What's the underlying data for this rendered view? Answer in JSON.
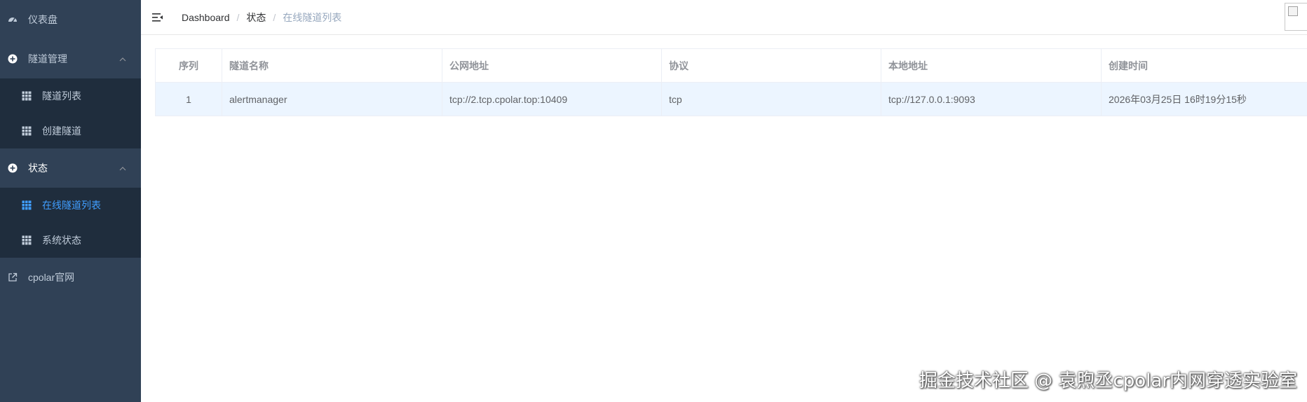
{
  "sidebar": {
    "items": [
      {
        "label": "仪表盘",
        "icon": "dashboard-icon"
      },
      {
        "label": "隧道管理",
        "icon": "plus-circle-icon",
        "expanded": true,
        "children": [
          {
            "label": "隧道列表",
            "icon": "table-icon"
          },
          {
            "label": "创建隧道",
            "icon": "table-icon"
          }
        ]
      },
      {
        "label": "状态",
        "icon": "plus-circle-icon",
        "expanded": true,
        "children": [
          {
            "label": "在线隧道列表",
            "icon": "table-icon",
            "active": true
          },
          {
            "label": "系统状态",
            "icon": "table-icon"
          }
        ]
      },
      {
        "label": "cpolar官网",
        "icon": "external-link-icon"
      }
    ]
  },
  "breadcrumb": [
    "Dashboard",
    "状态",
    "在线隧道列表"
  ],
  "table": {
    "columns": [
      "序列",
      "隧道名称",
      "公网地址",
      "协议",
      "本地地址",
      "创建时间"
    ],
    "rows": [
      [
        "1",
        "alertmanager",
        "tcp://2.tcp.cpolar.top:10409",
        "tcp",
        "tcp://127.0.0.1:9093",
        "2026年03月25日 16时19分15秒"
      ]
    ]
  },
  "watermark": "掘金技术社区 @ 袁煦丞cpolar内网穿透实验室",
  "colors": {
    "sidebar_bg": "#304156",
    "submenu_bg": "#1f2d3d",
    "active": "#409eff",
    "row_highlight": "#ecf5ff"
  }
}
